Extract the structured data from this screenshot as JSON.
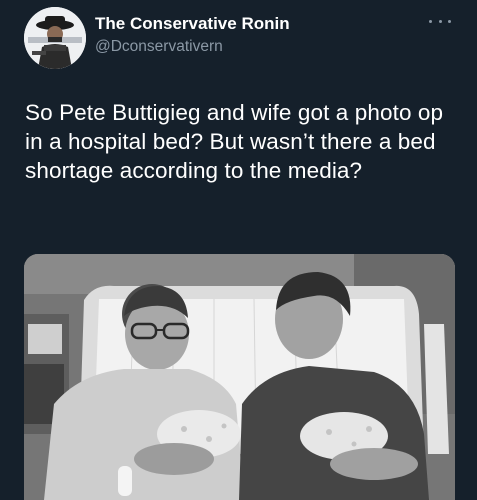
{
  "tweet": {
    "author": {
      "display_name": "The Conservative Ronin",
      "handle": "@Dconservativern"
    },
    "text": "So Pete Buttigieg and wife got a photo op in a hospital bed? But wasn’t there a bed shortage according to the media?",
    "media": {
      "icon": "hospital-bed-photo"
    }
  },
  "colors": {
    "background": "#15202b",
    "secondary_text": "#8b98a5",
    "primary_text": "#ffffff"
  }
}
